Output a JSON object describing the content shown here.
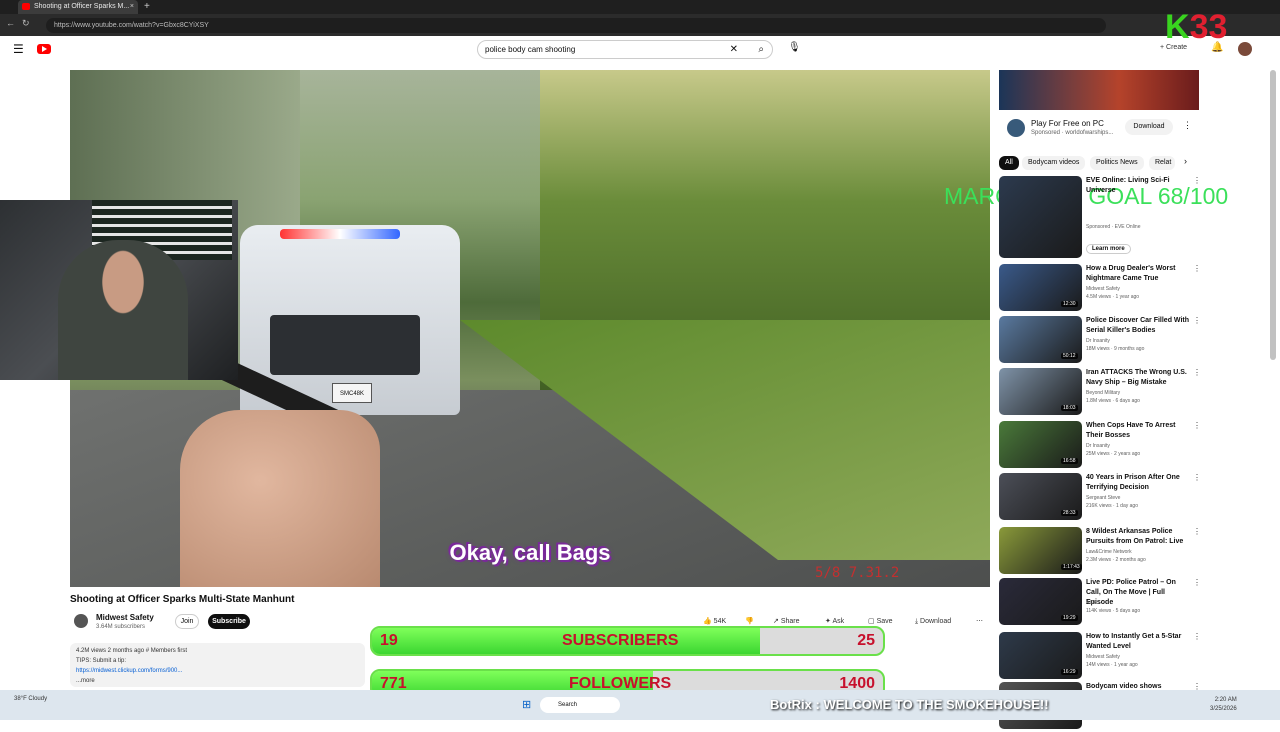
{
  "browser": {
    "tab_title": "Shooting at Officer Sparks M...",
    "url": "https://www.youtube.com/watch?v=Gbxc8CYiXSY"
  },
  "header": {
    "search_value": "police body cam shooting",
    "create_label": "Create"
  },
  "video": {
    "caption": "Okay, call Bags",
    "stamp": "5/8  7.31.2"
  },
  "overlays": {
    "goal": "MARCH SUB GOAL 68/100",
    "k_number": "33",
    "subscribers": {
      "current": "19",
      "label": "SUBSCRIBERS",
      "target": "25",
      "progress": 0.76
    },
    "followers": {
      "current": "771",
      "label": "FOLLOWERS",
      "target": "1400",
      "progress": 0.55
    }
  },
  "below": {
    "title": "Shooting at Officer Sparks Multi-State Manhunt",
    "channel": "Midwest Safety",
    "channel_subs": "3.64M subscribers",
    "join": "Join",
    "subscribe": "Subscribe",
    "likes": "54K",
    "share": "Share",
    "ask": "Ask",
    "save": "Save",
    "download": "Download",
    "desc_meta": "4.2M views  2 months ago  # Members first",
    "desc_line": "TIPS: Submit a tip:",
    "desc_link": "https://midwest.clickup.com/forms/900...",
    "desc_more": "...more"
  },
  "sidebar": {
    "ad": {
      "title": "Play For Free on PC",
      "sponsor": "Sponsored · worldofwarships...",
      "download": "Download"
    },
    "chips": [
      "All",
      "Bodycam videos",
      "Politics News",
      "Relat"
    ],
    "recs": [
      {
        "title": "EVE Online: Living Sci-Fi Universe",
        "channel": "Sponsored · EVE Online",
        "meta": "Learn more",
        "dur": "",
        "color": "#2c3a4e"
      },
      {
        "title": "How a Drug Dealer's Worst Nightmare Came True",
        "channel": "Midwest Safety",
        "meta": "4.5M views · 1 year ago",
        "dur": "12:30",
        "color": "#3a5a8a"
      },
      {
        "title": "Police Discover Car Filled With Serial Killer's Bodies",
        "channel": "Dr Insanity",
        "meta": "18M views · 9 months ago",
        "dur": "50:12",
        "color": "#5a7aa0"
      },
      {
        "title": "Iran ATTACKS The Wrong U.S. Navy Ship – Big Mistake",
        "channel": "Beyond Military",
        "meta": "1.8M views · 6 days ago",
        "dur": "18:03",
        "color": "#7f93a8"
      },
      {
        "title": "When Cops Have To Arrest Their Bosses",
        "channel": "Dr Insanity",
        "meta": "25M views · 2 years ago",
        "dur": "16:58",
        "color": "#4a7a3a"
      },
      {
        "title": "40 Years in Prison After One Terrifying Decision",
        "channel": "Sergeant Steve",
        "meta": "216K views · 1 day ago",
        "dur": "28:33",
        "color": "#4c4f58"
      },
      {
        "title": "8 Wildest Arkansas Police Pursuits from On Patrol: Live",
        "channel": "Law&Crime Network",
        "meta": "2.3M views · 2 months ago",
        "dur": "1:17:43",
        "color": "#8a9a3a"
      },
      {
        "title": "Live PD: Police Patrol – On Call, On The Move | Full Episode",
        "channel": "A&E",
        "meta": "114K views · 5 days ago",
        "dur": "19:29",
        "color": "#2a2a3a"
      },
      {
        "title": "How to Instantly Get a 5-Star Wanted Level",
        "channel": "Midwest Safety",
        "meta": "14M views · 1 year ago",
        "dur": "16:29",
        "color": "#2e3a4a"
      },
      {
        "title": "Bodycam video shows",
        "channel": "",
        "meta": "",
        "dur": "",
        "color": "#555"
      }
    ]
  },
  "taskbar": {
    "weather": "38°F Cloudy",
    "search": "Search",
    "botrix": "BotRix : WELCOME TO THE SMOKEHOUSE!!",
    "time": "2:20 AM",
    "date": "3/25/2026"
  }
}
